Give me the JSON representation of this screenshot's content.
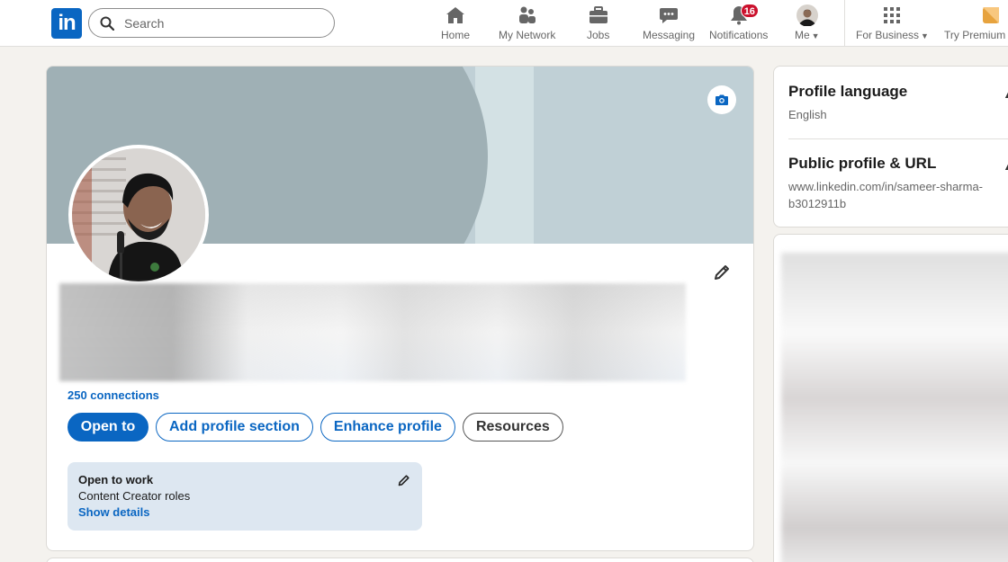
{
  "nav": {
    "logo_text": "in",
    "search_placeholder": "Search",
    "items": [
      {
        "label": "Home",
        "icon": "home-icon"
      },
      {
        "label": "My Network",
        "icon": "network-icon"
      },
      {
        "label": "Jobs",
        "icon": "briefcase-icon"
      },
      {
        "label": "Messaging",
        "icon": "chat-icon"
      },
      {
        "label": "Notifications",
        "icon": "bell-icon",
        "badge": "16"
      },
      {
        "label": "Me",
        "icon": "avatar"
      },
      {
        "label": "For Business",
        "icon": "grid-icon"
      },
      {
        "label": "Try Premium f",
        "icon": "premium-icon"
      }
    ]
  },
  "profile": {
    "connections": "250 connections",
    "buttons": {
      "open_to": "Open to",
      "add_section": "Add profile section",
      "enhance": "Enhance profile",
      "resources": "Resources"
    },
    "open_to_work": {
      "title": "Open to work",
      "roles": "Content Creator roles",
      "link": "Show details"
    }
  },
  "sidebar": {
    "language": {
      "heading": "Profile language",
      "value": "English"
    },
    "public_profile": {
      "heading": "Public profile & URL",
      "value": "www.linkedin.com/in/sameer-sharma-b3012911b"
    }
  },
  "colors": {
    "brand": "#0a66c2",
    "badge": "#cb112d",
    "banner": "#9fb0b5",
    "open_to_work_bg": "#dde7f1"
  }
}
